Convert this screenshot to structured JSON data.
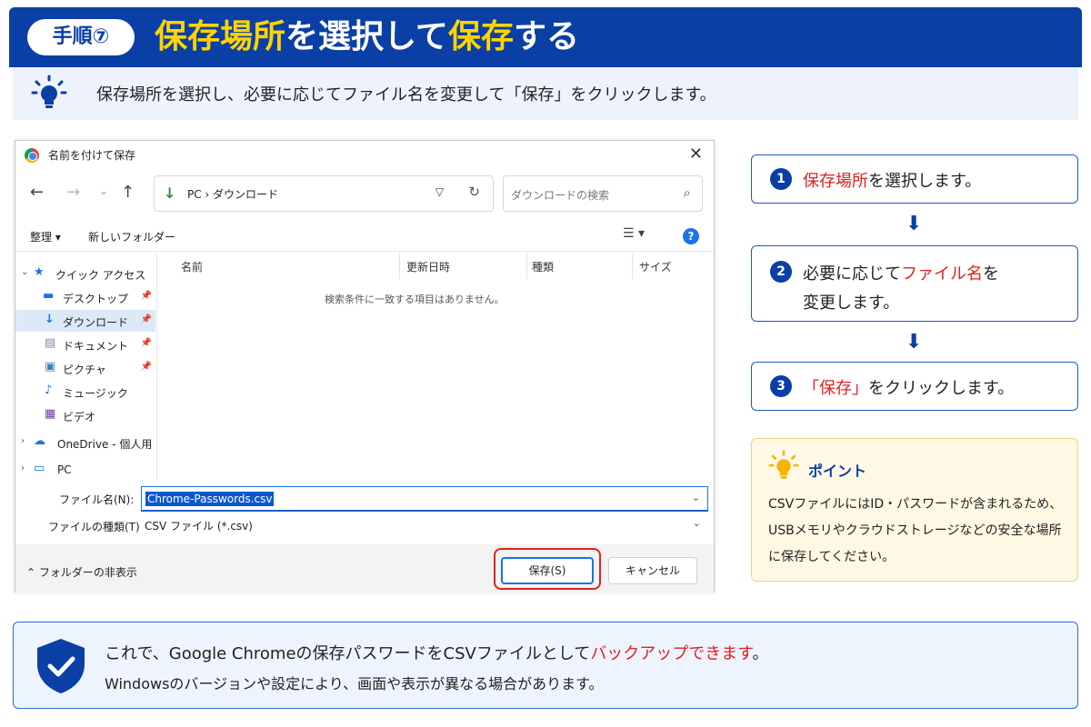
{
  "header": {
    "step_label": "手順⑦",
    "title_part1": "保存場所",
    "title_part2": "を選択して",
    "title_part3": "保存",
    "title_part4": "する"
  },
  "tip": {
    "text": "保存場所を選択し、必要に応じてファイル名を変更して「保存」をクリックします。"
  },
  "dialog": {
    "title": "名前を付けて保存",
    "close": "✕",
    "nav": {
      "back": "←",
      "forward": "→",
      "recent": "⌄",
      "up": "↑"
    },
    "address": {
      "path": "PC  ›  ダウンロード",
      "chevron": "›"
    },
    "search_placeholder": "ダウンロードの検索",
    "toolbar": {
      "organize": "整理 ▾",
      "new_folder": "新しいフォルダー",
      "help": "?"
    },
    "sidebar": [
      {
        "label": "クイック アクセス",
        "icon": "star-icon"
      },
      {
        "label": "デスクトップ",
        "icon": "desktop-icon"
      },
      {
        "label": "ダウンロード",
        "icon": "download-icon"
      },
      {
        "label": "ドキュメント",
        "icon": "document-icon"
      },
      {
        "label": "ピクチャ",
        "icon": "picture-icon"
      },
      {
        "label": "ミュージック",
        "icon": "music-icon"
      },
      {
        "label": "ビデオ",
        "icon": "video-icon"
      },
      {
        "label": "OneDrive - 個人用",
        "icon": "cloud-icon"
      },
      {
        "label": "PC",
        "icon": "computer-icon"
      }
    ],
    "columns": [
      "名前",
      "更新日時",
      "種類",
      "サイズ"
    ],
    "empty_message": "検索条件に一致する項目はありません。",
    "filename_label": "ファイル名(N):",
    "filename_value": "Chrome-Passwords.csv",
    "filetype_label": "ファイルの種類(T):",
    "filetype_value": "CSV ファイル (*.csv)",
    "hide_folders": "フォルダーの非表示",
    "save_button": "保存(S)",
    "cancel_button": "キャンセル"
  },
  "steps": [
    {
      "num": "1",
      "red": "保存場所",
      "rest": "を選択します。"
    },
    {
      "num": "2",
      "pre": "必要に応じて",
      "red": "ファイル名",
      "rest": "を",
      "line2": "変更します。"
    },
    {
      "num": "3",
      "red": "「保存」",
      "rest": "をクリックします。"
    }
  ],
  "point": {
    "title": "ポイント",
    "body": "CSVファイルにはID・パスワードが含まれるため、USBメモリやクラウドストレージなどの安全な場所に保存してください。"
  },
  "note": {
    "line1_pre": "これで、Google Chromeの保存パスワードをCSVファイルとして",
    "line1_red": "バックアップできます",
    "line1_post": "。",
    "line2": "Windowsのバージョンや設定により、画面や表示が異なる場合があります。"
  },
  "colors": {
    "brand_blue": "#0a3fa6",
    "accent_yellow": "#ffd400",
    "alert_red": "#e02020"
  }
}
